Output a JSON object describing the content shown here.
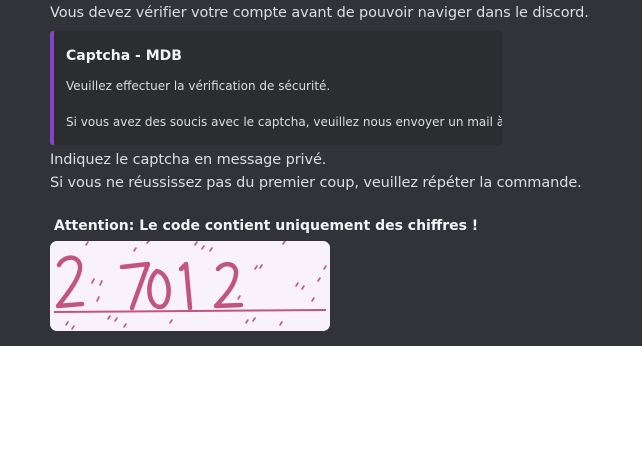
{
  "message": {
    "line1": "Vous devez vérifier votre compte avant de pouvoir naviger dans le discord.",
    "embed": {
      "title": "Captcha - MDB",
      "line1": "Veuillez effectuer la vérification de sécurité.",
      "line2": "Si vous avez des soucis avec le captcha, veuillez nous envoyer un mail à",
      "accent_color": "#8344c7"
    },
    "line2": "Indiquez le captcha en message privé.",
    "line3": " Si vous ne réussissez pas du premier coup, veuillez répéter la commande.",
    "attention": "Attention: Le code contient uniquement des chiffres !"
  },
  "captcha": {
    "code": "27012",
    "ink_color": "#c2557e",
    "background": "#faf2fb"
  }
}
